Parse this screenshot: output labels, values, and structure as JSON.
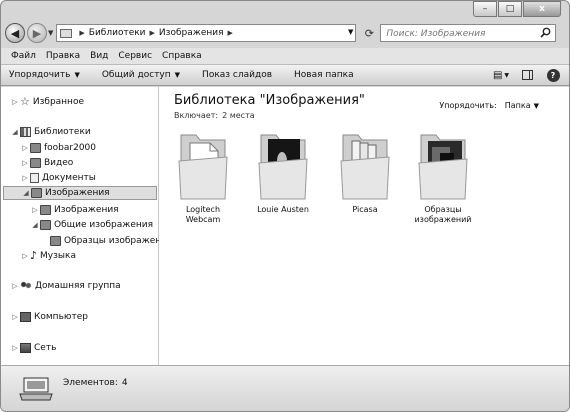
{
  "window": {
    "caption_minimize": "–",
    "caption_maximize": "□",
    "caption_close": "x"
  },
  "address": {
    "crumbs": [
      "Библиотеки",
      "Изображения"
    ],
    "search_placeholder": "Поиск: Изображения"
  },
  "menu": [
    "Файл",
    "Правка",
    "Вид",
    "Сервис",
    "Справка"
  ],
  "toolbar": {
    "organize": "Упорядочить",
    "share": "Общий доступ",
    "slideshow": "Показ слайдов",
    "new_folder": "Новая папка"
  },
  "nav": {
    "favorites": "Избранное",
    "libraries": "Библиотеки",
    "foobar": "foobar2000",
    "video": "Видео",
    "documents": "Документы",
    "images": "Изображения",
    "images_sub": "Изображения",
    "public_images": "Общие изображения",
    "sample_images": "Образцы изображений",
    "music": "Музыка",
    "homegroup": "Домашняя группа",
    "computer": "Компьютер",
    "network": "Сеть"
  },
  "content": {
    "title": "Библиотека \"Изображения\"",
    "includes_label": "Включает:",
    "includes_value": "2 места",
    "arrange_label": "Упорядочить:",
    "arrange_value": "Папка",
    "folders": [
      {
        "name_line1": "Logitech",
        "name_line2": "Webcam",
        "preview": "document"
      },
      {
        "name_line1": "Louie Austen",
        "name_line2": "",
        "preview": "photo"
      },
      {
        "name_line1": "Picasa",
        "name_line2": "",
        "preview": "pages"
      },
      {
        "name_line1": "Образцы",
        "name_line2": "изображений",
        "preview": "photo"
      }
    ]
  },
  "details": {
    "count_label": "Элементов:",
    "count_value": "4"
  }
}
